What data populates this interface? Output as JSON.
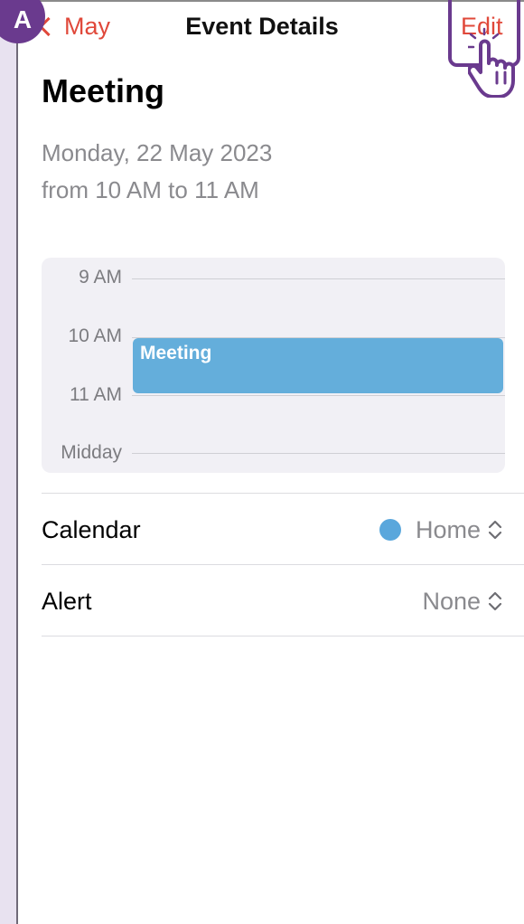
{
  "overlay": {
    "step_badge": "A"
  },
  "nav": {
    "back_label": "May",
    "title": "Event Details",
    "edit_label": "Edit"
  },
  "event": {
    "title": "Meeting",
    "date": "Monday, 22 May 2023",
    "time_range": "from 10 AM to 11 AM"
  },
  "day_preview": {
    "hours": [
      "9 AM",
      "10 AM",
      "11 AM",
      "Midday"
    ],
    "event_label": "Meeting"
  },
  "details": {
    "calendar_label": "Calendar",
    "calendar_value": "Home",
    "alert_label": "Alert",
    "alert_value": "None"
  },
  "colors": {
    "accent": "#e0483a",
    "calendar_home": "#5aa7dc",
    "event_block": "#64aedb",
    "overlay_purple": "#6a3a8e"
  },
  "icons": {
    "back": "chevron-left-icon",
    "pointer": "hand-pointer-icon",
    "calendar_picker": "chevron-up-down-icon",
    "alert_picker": "chevron-up-down-icon"
  }
}
